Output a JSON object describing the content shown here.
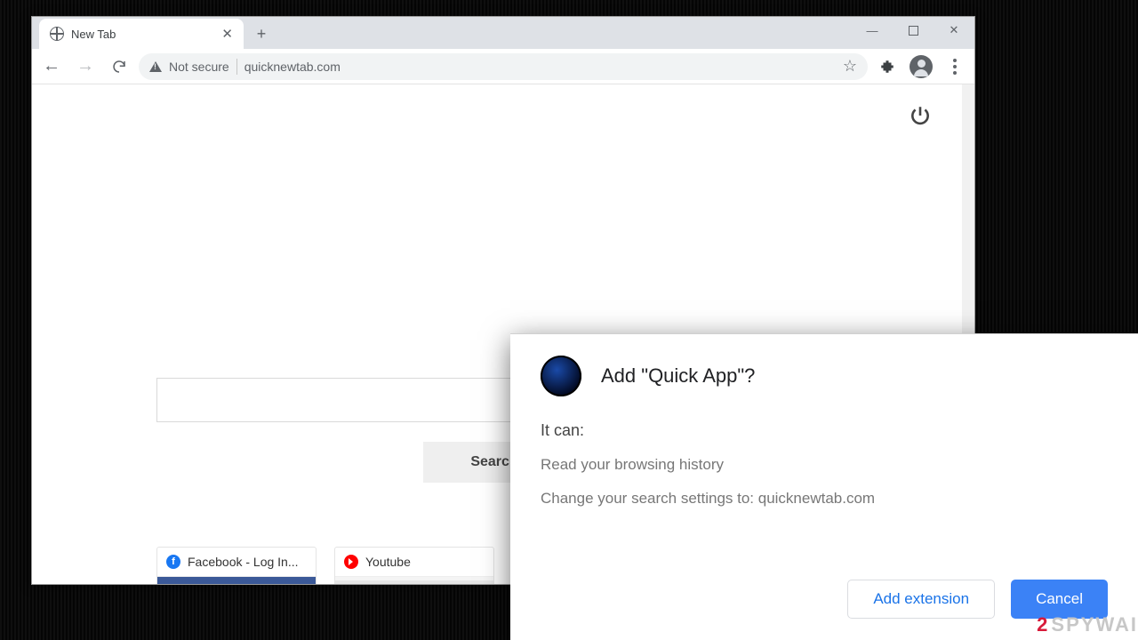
{
  "window": {
    "minimize": "—",
    "close": "✕"
  },
  "tab": {
    "title": "New Tab"
  },
  "toolbar": {
    "insecure_label": "Not secure",
    "url": "quicknewtab.com"
  },
  "page": {
    "search_button": "Search",
    "quicklinks": [
      {
        "label": "Facebook - Log In...",
        "fav_text": "f"
      },
      {
        "label": "Youtube",
        "fav_text": ""
      },
      {
        "label": "",
        "fav_text": ""
      }
    ]
  },
  "dialog": {
    "title": "Add \"Quick App\"?",
    "it_can": "It can:",
    "perm1": "Read your browsing history",
    "perm2": "Change your search settings to: quicknewtab.com",
    "add": "Add extension",
    "cancel": "Cancel"
  },
  "watermark": {
    "two": "2",
    "rest": "SPYWAI"
  }
}
